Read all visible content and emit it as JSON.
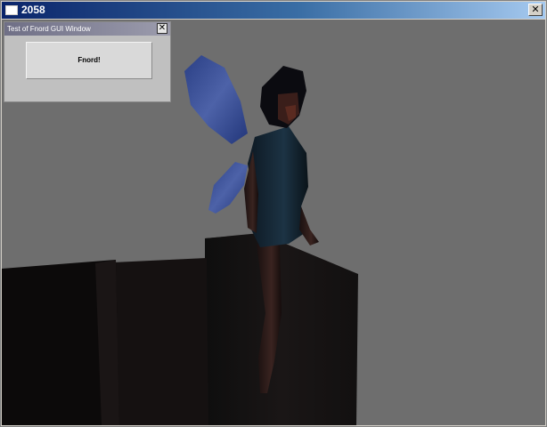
{
  "app": {
    "title": "2058",
    "close_glyph": "✕"
  },
  "gui_window": {
    "title": "Test of Fnord GUI Window",
    "close_glyph": "✕",
    "button_label": "Fnord!"
  },
  "colors": {
    "viewport_background": "#6e6e6e",
    "titlebar_start": "#0a246a",
    "titlebar_end": "#a6caf0"
  },
  "scene": {
    "subject": "winged fairy figure sitting on dark blocks",
    "wing_color": "#3a4f95"
  }
}
